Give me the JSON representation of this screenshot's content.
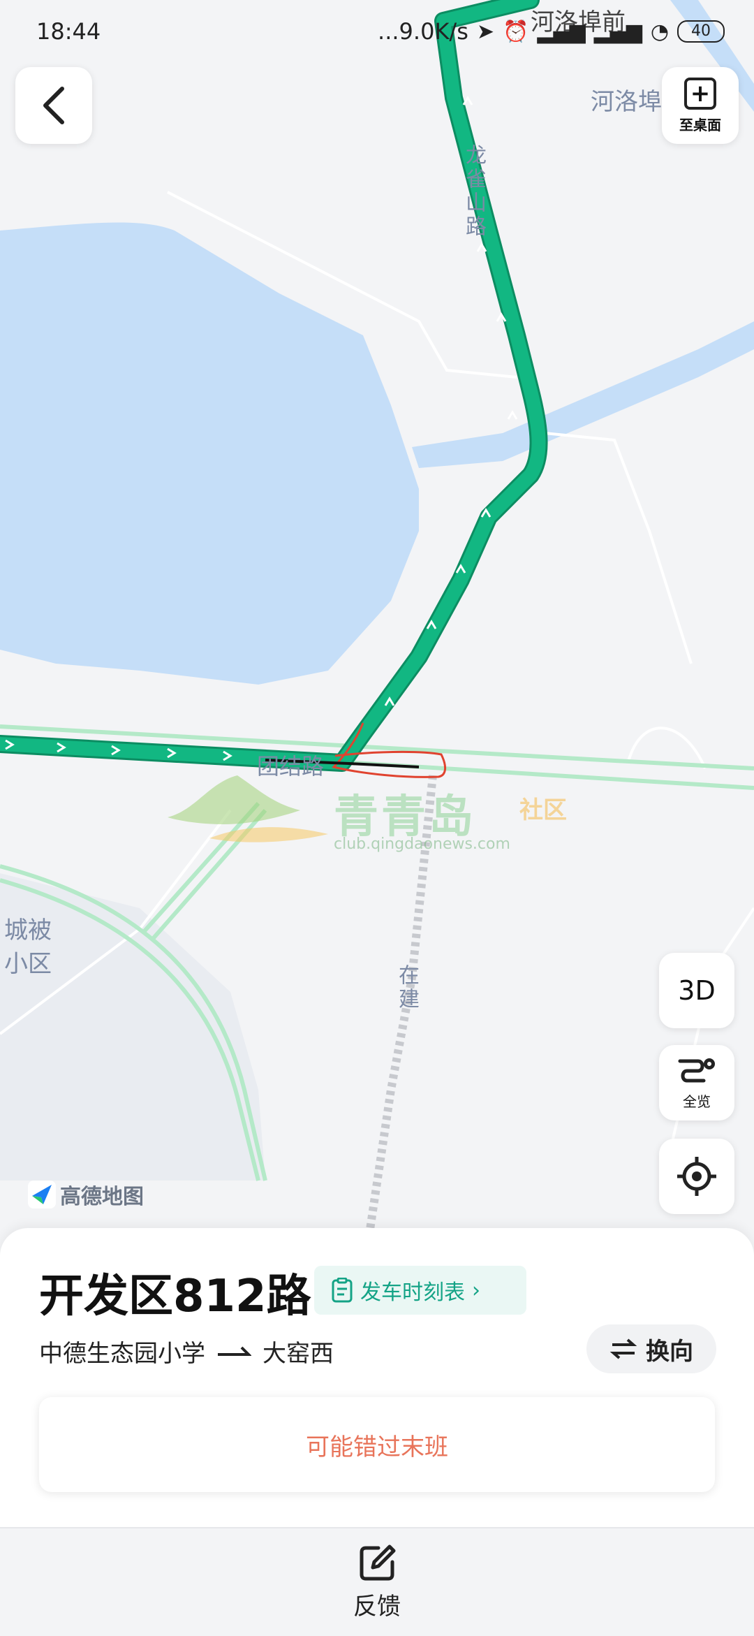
{
  "status_bar": {
    "time": "18:44",
    "network_speed": "...9.0K/s",
    "battery": "40",
    "icons": [
      "location-icon",
      "alarm-icon",
      "signal-icon",
      "signal-icon",
      "wifi-icon",
      "battery-icon"
    ]
  },
  "nav": {
    "back_icon": "back-arrow-icon",
    "add_to_desktop_label": "至桌面"
  },
  "map": {
    "labels": {
      "heluobu_qian": "河洛埠前",
      "heluobu": "河洛埠",
      "longque_road": "龙雀山路",
      "tuanjie_road": "团结路",
      "chengbei_line1": "城被",
      "chengbei_line2": "小区",
      "under_construction": "在建"
    },
    "logo_text": "高德地图",
    "watermark": {
      "title": "青青岛",
      "suffix": "社区",
      "url": "club.qingdaonews.com"
    },
    "controls": {
      "three_d": "3D",
      "overview": "全览"
    },
    "colors": {
      "route": "#12b782",
      "water": "#c5def8",
      "annotation": "#e0432f"
    }
  },
  "route": {
    "name": "开发区812路",
    "timetable_label": "发车时刻表",
    "from": "中德生态园小学",
    "to": "大窑西",
    "reverse_label": "换向",
    "missed_notice": "可能错过末班"
  },
  "bottom": {
    "feedback_label": "反馈"
  }
}
